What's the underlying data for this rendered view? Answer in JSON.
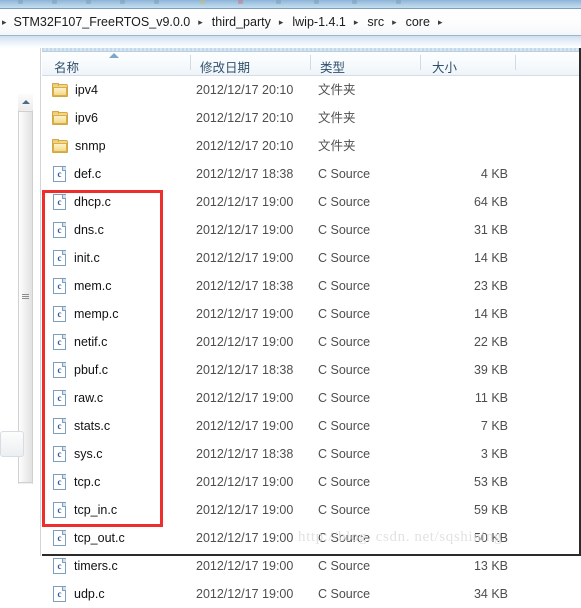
{
  "breadcrumb": {
    "leading_separator": "▸",
    "separator": "▸",
    "items": [
      {
        "label": "STM32F107_FreeRTOS_v9.0.0"
      },
      {
        "label": "third_party"
      },
      {
        "label": "lwip-1.4.1"
      },
      {
        "label": "src"
      },
      {
        "label": "core"
      }
    ]
  },
  "columns": [
    {
      "key": "name",
      "label": "名称"
    },
    {
      "key": "date",
      "label": "修改日期"
    },
    {
      "key": "type",
      "label": "类型"
    },
    {
      "key": "size",
      "label": "大小"
    }
  ],
  "sort": {
    "column": "名称",
    "direction": "ascending",
    "indicator": "sort-ascending-arrow"
  },
  "file_list": [
    {
      "name": "ipv4",
      "icon": "folder-icon",
      "date": "2012/12/17 20:10",
      "type": "文件夹",
      "size": ""
    },
    {
      "name": "ipv6",
      "icon": "folder-icon",
      "date": "2012/12/17 20:10",
      "type": "文件夹",
      "size": ""
    },
    {
      "name": "snmp",
      "icon": "folder-icon",
      "date": "2012/12/17 20:10",
      "type": "文件夹",
      "size": ""
    },
    {
      "name": "def.c",
      "icon": "c-source-icon",
      "date": "2012/12/17 18:38",
      "type": "C Source",
      "size": "4 KB"
    },
    {
      "name": "dhcp.c",
      "icon": "c-source-icon",
      "date": "2012/12/17 19:00",
      "type": "C Source",
      "size": "64 KB"
    },
    {
      "name": "dns.c",
      "icon": "c-source-icon",
      "date": "2012/12/17 19:00",
      "type": "C Source",
      "size": "31 KB"
    },
    {
      "name": "init.c",
      "icon": "c-source-icon",
      "date": "2012/12/17 19:00",
      "type": "C Source",
      "size": "14 KB"
    },
    {
      "name": "mem.c",
      "icon": "c-source-icon",
      "date": "2012/12/17 18:38",
      "type": "C Source",
      "size": "23 KB"
    },
    {
      "name": "memp.c",
      "icon": "c-source-icon",
      "date": "2012/12/17 19:00",
      "type": "C Source",
      "size": "14 KB"
    },
    {
      "name": "netif.c",
      "icon": "c-source-icon",
      "date": "2012/12/17 19:00",
      "type": "C Source",
      "size": "22 KB"
    },
    {
      "name": "pbuf.c",
      "icon": "c-source-icon",
      "date": "2012/12/17 18:38",
      "type": "C Source",
      "size": "39 KB"
    },
    {
      "name": "raw.c",
      "icon": "c-source-icon",
      "date": "2012/12/17 19:00",
      "type": "C Source",
      "size": "11 KB"
    },
    {
      "name": "stats.c",
      "icon": "c-source-icon",
      "date": "2012/12/17 19:00",
      "type": "C Source",
      "size": "7 KB"
    },
    {
      "name": "sys.c",
      "icon": "c-source-icon",
      "date": "2012/12/17 18:38",
      "type": "C Source",
      "size": "3 KB"
    },
    {
      "name": "tcp.c",
      "icon": "c-source-icon",
      "date": "2012/12/17 19:00",
      "type": "C Source",
      "size": "53 KB"
    },
    {
      "name": "tcp_in.c",
      "icon": "c-source-icon",
      "date": "2012/12/17 19:00",
      "type": "C Source",
      "size": "59 KB"
    },
    {
      "name": "tcp_out.c",
      "icon": "c-source-icon",
      "date": "2012/12/17 19:00",
      "type": "C Source",
      "size": "50 KB"
    },
    {
      "name": "timers.c",
      "icon": "c-source-icon",
      "date": "2012/12/17 19:00",
      "type": "C Source",
      "size": "13 KB"
    },
    {
      "name": "udp.c",
      "icon": "c-source-icon",
      "date": "2012/12/17 19:00",
      "type": "C Source",
      "size": "34 KB"
    }
  ],
  "annotation": {
    "shape": "rectangle",
    "color": "#ee2d2d",
    "covers_from": "def.c",
    "covers_to": "udp.c"
  },
  "watermark": {
    "text": "http://blog. csdn. net/sqshining"
  },
  "icon_glyphs": {
    "c_source_letter": "c"
  },
  "colors": {
    "annotation_red": "#ee2d2d",
    "header_text": "#30506b",
    "folder_yellow": "#e8bf63",
    "c_icon_blue": "#2a5d96",
    "watermark_gray": "#e2e2e2"
  }
}
